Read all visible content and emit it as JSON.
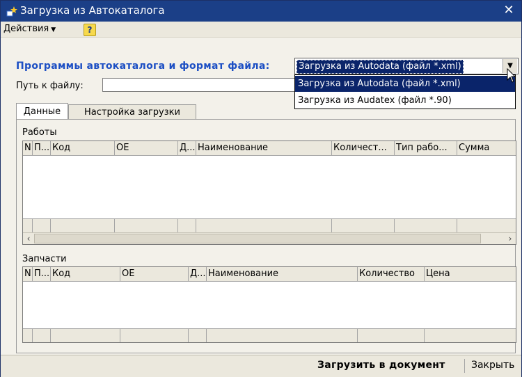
{
  "window": {
    "title": "Загрузка из Автокаталога",
    "close_glyph": "✕"
  },
  "menu": {
    "actions_label": "Действия",
    "actions_arrow": "▼",
    "help_glyph": "?"
  },
  "form": {
    "programs_label": "Программы автокаталога и формат файла:",
    "combo_value": "Загрузка из Autodata (файл *.xml)",
    "combo_arrow": "▼",
    "options": [
      "Загрузка из Autodata (файл *.xml)",
      "Загрузка из Audatex (файл *.90)"
    ],
    "path_label": "Путь к файлу:",
    "path_value": ""
  },
  "tabs": [
    {
      "label": "Данные"
    },
    {
      "label": "Настройка загрузки"
    }
  ],
  "works": {
    "label": "Работы",
    "columns": [
      "N",
      "П...",
      "Код",
      "ОЕ",
      "Д...",
      "Наименование",
      "Количест...",
      "Тип рабо...",
      "Сумма"
    ],
    "scroll_left": "‹",
    "scroll_right": "›"
  },
  "parts": {
    "label": "Запчасти",
    "columns": [
      "N",
      "П...",
      "Код",
      "ОЕ",
      "Д...",
      "Наименование",
      "Количество",
      "Цена"
    ]
  },
  "footer": {
    "load_label": "Загрузить в документ",
    "close_label": "Закрыть"
  },
  "colors": {
    "titlebar": "#1b3f87",
    "selection": "#0a246a",
    "accent_label": "#1c4fc4"
  }
}
